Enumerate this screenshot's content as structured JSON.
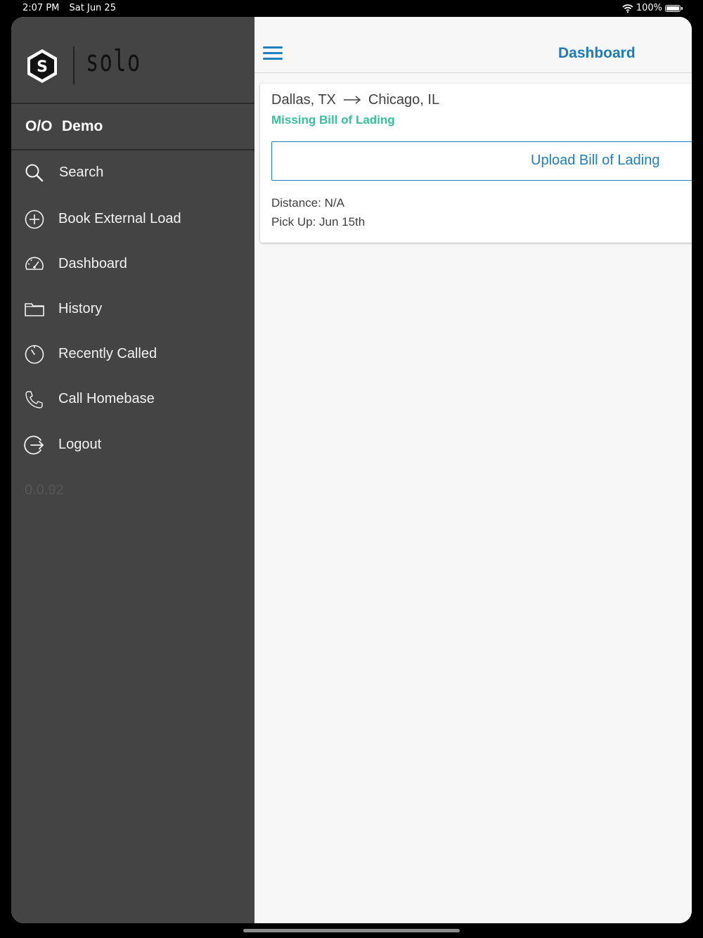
{
  "status_bar": {
    "time": "2:07 PM",
    "date": "Sat Jun 25",
    "battery": "100%"
  },
  "drawer": {
    "brand": "solo",
    "brand_mark": "S",
    "user": {
      "role": "O/O",
      "name": "Demo"
    },
    "menu": [
      {
        "label": "Search",
        "icon": "search-icon"
      },
      {
        "label": "Book External Load",
        "icon": "plus-circle-icon"
      },
      {
        "label": "Dashboard",
        "icon": "speedometer-icon"
      },
      {
        "label": "History",
        "icon": "folder-icon"
      },
      {
        "label": "Recently Called",
        "icon": "timer-icon"
      },
      {
        "label": "Call Homebase",
        "icon": "phone-icon"
      },
      {
        "label": "Logout",
        "icon": "logout-icon"
      }
    ],
    "version": "0.0.92"
  },
  "header": {
    "title": "Dashboard",
    "menu_icon": "hamburger-icon"
  },
  "load": {
    "origin": "Dallas, TX",
    "destination": "Chicago, IL",
    "status": "Missing Bill of Lading",
    "action": "Upload Bill of Lading",
    "distance": "Distance: N/A",
    "pickup": "Pick Up: Jun 15th"
  },
  "colors": {
    "accent": "#1f7fbf",
    "status_green": "#34c39a",
    "drawer_bg": "#444444"
  }
}
